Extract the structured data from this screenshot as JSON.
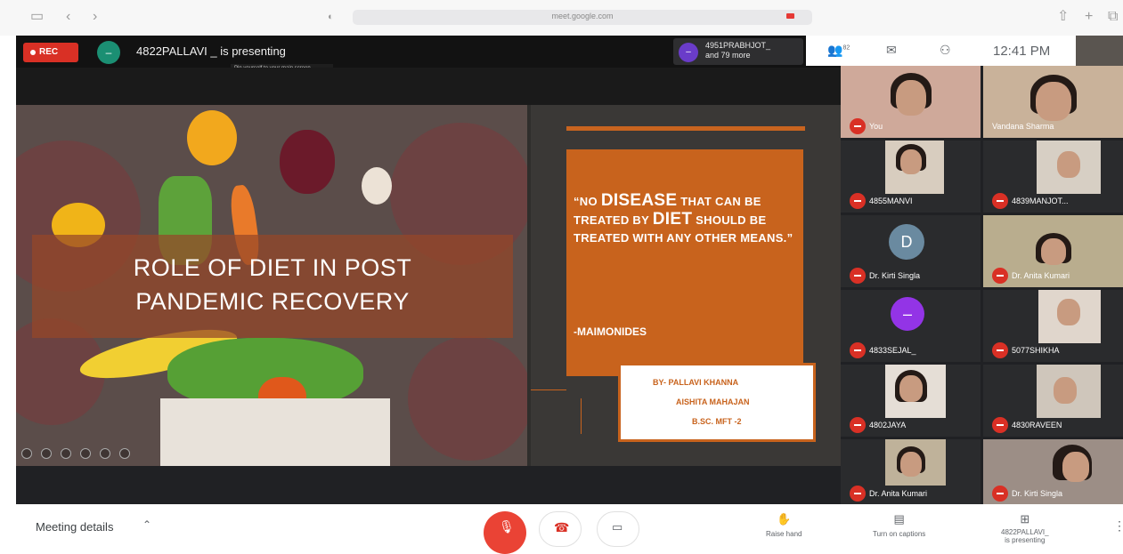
{
  "browser": {
    "url": "meet.google.com",
    "icons": [
      "sidebar-icon",
      "back-icon",
      "forward-icon",
      "shield-icon",
      "share-icon",
      "new-tab-icon",
      "tabs-icon"
    ]
  },
  "meet": {
    "rec_label": "REC",
    "presenter_initial": "–",
    "presenting_text": "4822PALLAVI _ is presenting",
    "viewer_initial": "–",
    "viewer_name_line1": "4951PRABHJOT_",
    "viewer_name_line2": "and 79 more",
    "participant_count": "82",
    "clock": "12:41  PM",
    "pin_hint": "Pin yourself to your main screen"
  },
  "slide": {
    "title_line1": "ROLE OF DIET IN POST",
    "title_line2": "PANDEMIC RECOVERY",
    "quote_part1": "“NO ",
    "quote_big1": "DISEASE",
    "quote_part2": " THAT CAN BE TREATED BY ",
    "quote_big2": "DIET",
    "quote_part3": " SHOULD BE TREATED WITH ANY OTHER MEANS.”",
    "author": "-MAIMONIDES",
    "credit_line1": "BY- PALLAVI KHANNA",
    "credit_line2": "AISHITA MAHAJAN",
    "credit_line3": "B.SC. MFT -2",
    "colors": {
      "accent": "#c8631d",
      "title_band": "#964628"
    }
  },
  "participants": [
    {
      "name": "You",
      "type": "video"
    },
    {
      "name": "Vandana Sharma",
      "type": "video"
    },
    {
      "name": "4855MANVI",
      "type": "video"
    },
    {
      "name": "4839MANJOT...",
      "type": "video"
    },
    {
      "name": "Dr. Kirti Singla",
      "type": "avatar",
      "initial": "D"
    },
    {
      "name": "Dr. Anita Kumari",
      "type": "video"
    },
    {
      "name": "4833SEJAL_",
      "type": "avatar",
      "initial": "–"
    },
    {
      "name": "5077SHIKHA",
      "type": "video"
    },
    {
      "name": "4802JAYA",
      "type": "video"
    },
    {
      "name": "4830RAVEEN",
      "type": "video"
    },
    {
      "name": "Dr. Anita Kumari",
      "type": "video"
    },
    {
      "name": "Dr. Kirti Singla",
      "type": "video"
    }
  ],
  "bottom_bar": {
    "meeting_details": "Meeting details",
    "raise_hand": "Raise hand",
    "captions": "Turn on captions",
    "presenting_line1": "4822PALLAVI_",
    "presenting_line2": "is presenting"
  }
}
